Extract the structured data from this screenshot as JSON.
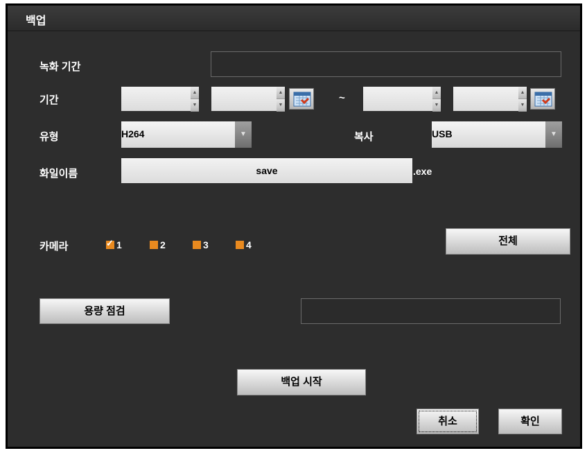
{
  "dialog": {
    "title": "백업"
  },
  "labels": {
    "record_period": "녹화 기간",
    "period": "기간",
    "type": "유형",
    "copy": "복사",
    "filename": "화일이름",
    "camera": "카메라",
    "tilde": "~"
  },
  "fields": {
    "record_period_value": "",
    "start_date": "",
    "start_time": "",
    "end_date": "",
    "end_time": "",
    "filename_value": "save",
    "filename_ext": ".exe",
    "capacity_result": ""
  },
  "selects": {
    "type_value": "H264",
    "copy_value": "USB"
  },
  "cameras": [
    {
      "label": "1",
      "checked": true
    },
    {
      "label": "2",
      "checked": false
    },
    {
      "label": "3",
      "checked": false
    },
    {
      "label": "4",
      "checked": false
    }
  ],
  "buttons": {
    "all": "전체",
    "check_capacity": "용량 점검",
    "start_backup": "백업 시작",
    "cancel": "취소",
    "ok": "확인"
  },
  "icons": {
    "spin_up": "▲",
    "spin_down": "▼",
    "dropdown": "▼",
    "calendar": "calendar-icon"
  },
  "colors": {
    "background": "#2d2d2d",
    "checkbox": "#e98a1f"
  }
}
